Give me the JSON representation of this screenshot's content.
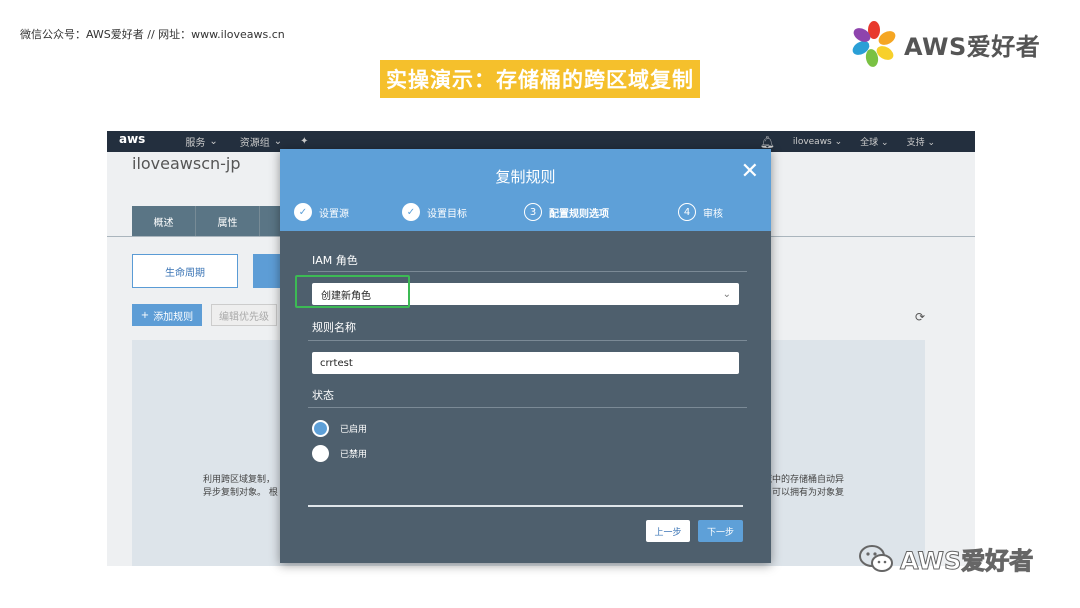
{
  "slide": {
    "header_left": "微信公众号：AWS爱好者 // 网址：www.iloveaws.cn",
    "logo_text": "AWS爱好者",
    "title": "实操演示：存储桶的跨区域复制",
    "watermark": "AWS爱好者"
  },
  "console": {
    "aws_logo": "aws",
    "nav": {
      "services": "服务",
      "resource_groups": "资源组",
      "account": "iloveaws",
      "region": "全球",
      "support": "支持"
    },
    "bucket_name": "iloveawscn-jp",
    "tabs": [
      "概述",
      "属性",
      ""
    ],
    "lifecycle_label": "生命周期",
    "add_rule_label": "添加规则",
    "edit_priority_label": "编辑优先级",
    "bg_text_left": [
      "利用跨区域复制，",
      "异步复制对象。 根"
    ],
    "bg_text_right": [
      "域中的存储桶自动异",
      "户可以拥有为对象复"
    ]
  },
  "modal": {
    "title": "复制规则",
    "steps": [
      {
        "label": "设置源",
        "state": "done",
        "marker": "✓"
      },
      {
        "label": "设置目标",
        "state": "done",
        "marker": "✓"
      },
      {
        "label": "配置规则选项",
        "state": "current",
        "marker": "3"
      },
      {
        "label": "审核",
        "state": "pending",
        "marker": "4"
      }
    ],
    "iam_label": "IAM 角色",
    "iam_value": "创建新角色",
    "rule_name_label": "规则名称",
    "rule_name_value": "crrtest",
    "status_label": "状态",
    "status_options": [
      {
        "label": "已启用",
        "selected": true
      },
      {
        "label": "已禁用",
        "selected": false
      }
    ],
    "prev_label": "上一步",
    "next_label": "下一步"
  },
  "colors": {
    "accent": "#5ea0d8",
    "modal_bg": "#4e5f6d",
    "title_bg": "#f5c02c",
    "highlight": "#3cba54",
    "nav_bg": "#232f3e"
  }
}
